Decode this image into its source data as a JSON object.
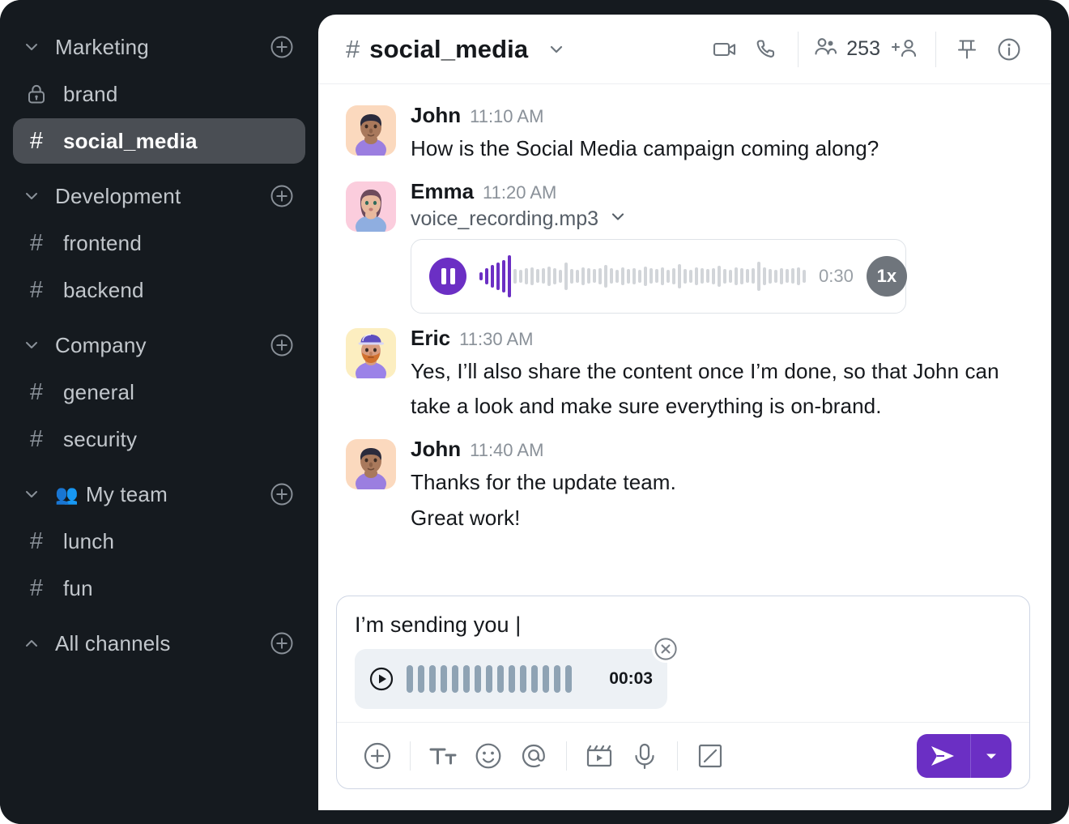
{
  "sidebar": {
    "sections": [
      {
        "label": "Marketing",
        "chevron": "chevron-down",
        "add": "add-channel"
      },
      {
        "label": "Development",
        "chevron": "chevron-down",
        "add": "add-channel"
      },
      {
        "label": "Company",
        "chevron": "chevron-down",
        "add": "add-channel"
      },
      {
        "label": "My team",
        "emoji": "👥",
        "chevron": "chevron-down",
        "add": "add-channel"
      },
      {
        "label": "All channels",
        "chevron": "chevron-up",
        "add": "add-channel"
      }
    ],
    "marketing_channels": [
      {
        "name": "brand",
        "icon": "lock",
        "active": false
      },
      {
        "name": "social_media",
        "icon": "hash",
        "active": true
      }
    ],
    "development_channels": [
      {
        "name": "frontend",
        "icon": "hash",
        "active": false
      },
      {
        "name": "backend",
        "icon": "hash",
        "active": false
      }
    ],
    "company_channels": [
      {
        "name": "general",
        "icon": "hash",
        "active": false
      },
      {
        "name": "security",
        "icon": "hash",
        "active": false
      }
    ],
    "team_channels": [
      {
        "name": "lunch",
        "icon": "hash",
        "active": false
      },
      {
        "name": "fun",
        "icon": "hash",
        "active": false
      }
    ]
  },
  "header": {
    "hash": "#",
    "channel": "social_media",
    "member_count": "253",
    "icons": [
      "video-camera-icon",
      "phone-icon",
      "people-icon",
      "add-person-icon",
      "pin-icon",
      "info-icon"
    ]
  },
  "messages": [
    {
      "author": "John",
      "time": "11:10 AM",
      "text": "How is the Social Media campaign coming along?",
      "avatar": "john"
    },
    {
      "author": "Emma",
      "time": "11:20 AM",
      "file_name": "voice_recording.mp3",
      "avatar": "emma",
      "audio": {
        "duration": "0:30",
        "speed": "1x",
        "state": "playing"
      }
    },
    {
      "author": "Eric",
      "time": "11:30 AM",
      "text": "Yes, I’ll also share the content once I’m done, so that John can take a look and make sure everything is on-brand.",
      "avatar": "eric"
    },
    {
      "author": "John",
      "time": "11:40 AM",
      "text_line1": "Thanks for the update team.",
      "text_line2": "Great work!",
      "avatar": "john2"
    }
  ],
  "composer": {
    "draft_text": "I’m sending you",
    "caret": "|",
    "draft_audio": {
      "duration": "00:03",
      "state": "paused"
    },
    "toolbar": [
      "plus-circle-icon",
      "text-format-icon",
      "emoji-icon",
      "mention-icon",
      "video-clip-icon",
      "microphone-icon",
      "slash-command-icon"
    ],
    "send_label": "send-icon",
    "send_caret_label": "chevron-down-icon"
  },
  "colors": {
    "accent": "#6B2FC4",
    "sidebar_bg": "#151A1F",
    "sidebar_active": "#4A4E54",
    "text_dark": "#15181C",
    "text_muted": "#8A9199",
    "draft_wave": "#8FA3B4"
  }
}
